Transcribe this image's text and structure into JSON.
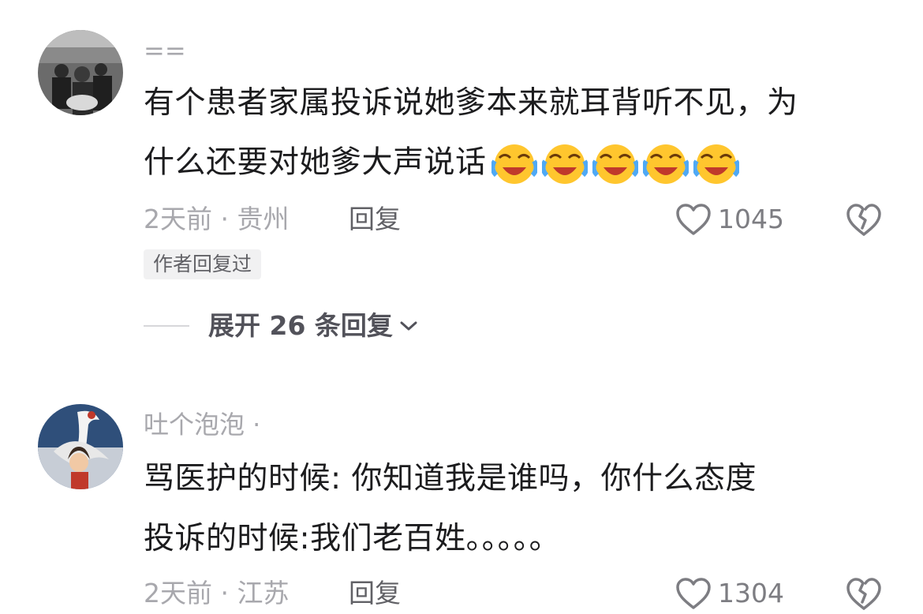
{
  "comments": [
    {
      "username": "==",
      "lines": [
        "有个患者家属投诉说她爹本来就耳背听不见，为",
        "什么还要对她爹大声说话"
      ],
      "emojis": [
        "laugh-cry-emoji",
        "laugh-cry-emoji",
        "laugh-cry-emoji",
        "laugh-cry-emoji",
        "laugh-cry-emoji"
      ],
      "meta": "2天前 · 贵州",
      "reply_label": "回复",
      "like_count": "1045",
      "badge": "作者回复过",
      "expand_label": "展开 26 条回复"
    },
    {
      "username": "吐个泡泡 ·",
      "lines": [
        "骂医护的时候: 你知道我是谁吗，你什么态度",
        "投诉的时候:我们老百姓。。。。。"
      ],
      "meta": "2天前 · 江苏",
      "reply_label": "回复",
      "like_count": "1304"
    }
  ],
  "colors": {
    "text": "#1c1c1e",
    "muted": "#a8a8ad",
    "badge_bg": "#f1f1f2",
    "emoji_yellow": "#ffc62e",
    "emoji_tear": "#4fa9f5"
  }
}
